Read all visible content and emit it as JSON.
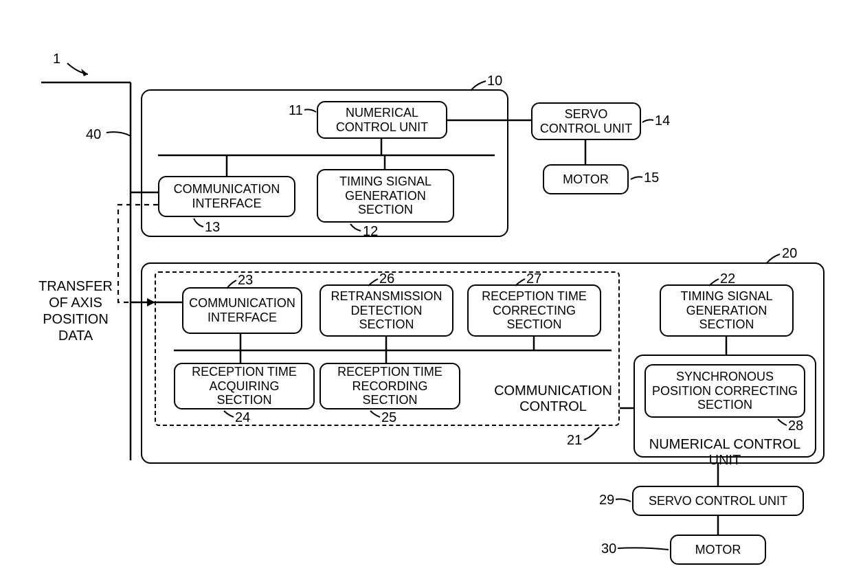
{
  "figure": {
    "ref_1": "1",
    "ref_40": "40",
    "side_label": "TRANSFER\nOF AXIS\nPOSITION\nDATA"
  },
  "upper": {
    "ref_10": "10",
    "numerical_control": {
      "label": "NUMERICAL\nCONTROL UNIT",
      "ref": "11"
    },
    "timing": {
      "label": "TIMING SIGNAL\nGENERATION\nSECTION",
      "ref": "12"
    },
    "comm_if": {
      "label": "COMMUNICATION\nINTERFACE",
      "ref": "13"
    },
    "servo": {
      "label": "SERVO\nCONTROL UNIT",
      "ref": "14"
    },
    "motor": {
      "label": "MOTOR",
      "ref": "15"
    }
  },
  "lower": {
    "ref_20": "20",
    "comm_control_ref": "21",
    "comm_if": {
      "label": "COMMUNICATION\nINTERFACE",
      "ref": "23"
    },
    "retrans": {
      "label": "RETRANSMISSION\nDETECTION\nSECTION",
      "ref": "26"
    },
    "recep_correct": {
      "label": "RECEPTION TIME\nCORRECTING\nSECTION",
      "ref": "27"
    },
    "recep_acquire": {
      "label": "RECEPTION TIME\nACQUIRING\nSECTION",
      "ref": "24"
    },
    "recep_record": {
      "label": "RECEPTION TIME\nRECORDING\nSECTION",
      "ref": "25"
    },
    "timing": {
      "label": "TIMING SIGNAL\nGENERATION\nSECTION",
      "ref": "22"
    },
    "sync": {
      "label": "SYNCHRONOUS\nPOSITION CORRECTING\nSECTION",
      "ref": "28"
    },
    "num_ctrl_label": "NUMERICAL CONTROL UNIT",
    "comm_ctrl_label": "COMMUNICATION\nCONTROL",
    "servo": {
      "label": "SERVO CONTROL UNIT",
      "ref": "29"
    },
    "motor": {
      "label": "MOTOR",
      "ref": "30"
    }
  }
}
